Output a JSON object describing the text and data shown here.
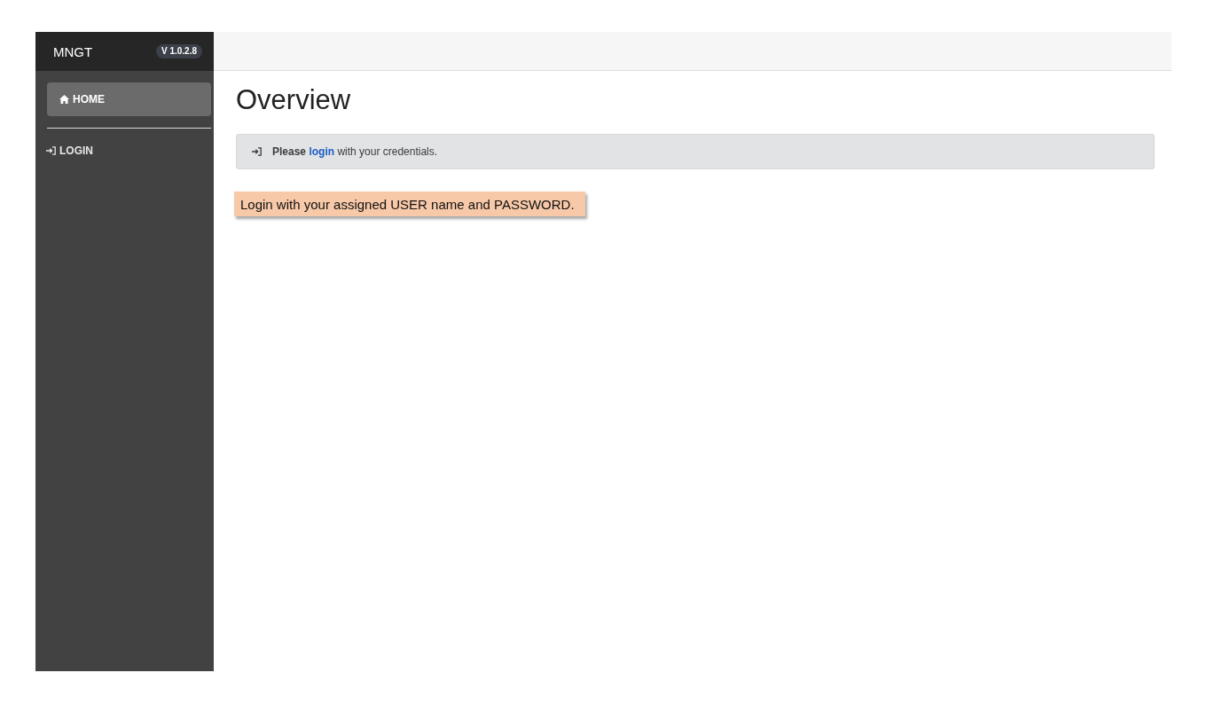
{
  "sidebar": {
    "brand": "MNGT",
    "version": "V 1.0.2.8",
    "items": [
      {
        "kind": "home",
        "label": "HOME",
        "selected": true
      },
      {
        "kind": "login",
        "label": "LOGIN",
        "selected": false
      }
    ]
  },
  "main": {
    "heading": "Overview",
    "alert": {
      "lead": "Please",
      "link": "login",
      "rest": "with your credentials."
    },
    "note": "Login with your assigned USER name and PASSWORD."
  }
}
